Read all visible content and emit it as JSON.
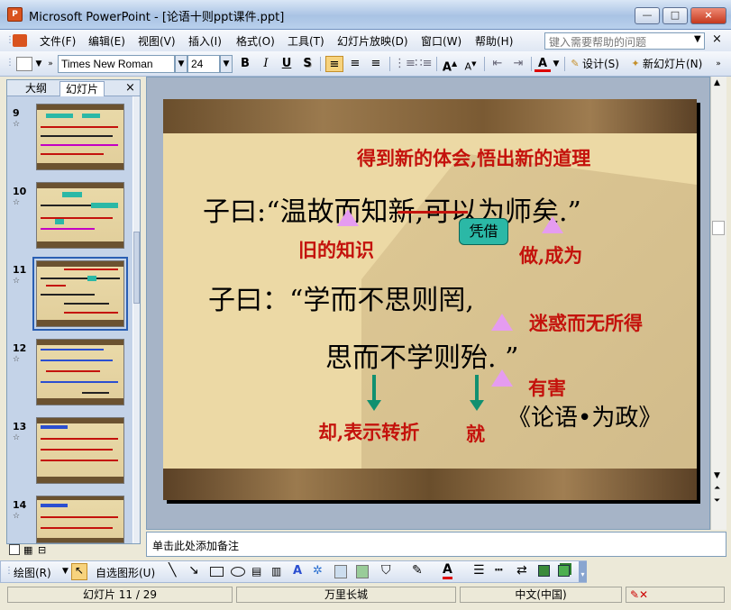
{
  "window": {
    "title": "Microsoft PowerPoint - [论语十则ppt课件.ppt]",
    "minimize": "0",
    "restore": "□",
    "close": "×"
  },
  "menu": [
    "文件(F)",
    "编辑(E)",
    "视图(V)",
    "插入(I)",
    "格式(O)",
    "工具(T)",
    "幻灯片放映(D)",
    "窗口(W)",
    "帮助(H)"
  ],
  "help": {
    "placeholder": "键入需要帮助的问题"
  },
  "toolbar": {
    "font": "Times New Roman",
    "size": "24",
    "bold": "B",
    "italic": "I",
    "underline": "U",
    "shadow": "S",
    "design": "设计(S)",
    "new_slide": "新幻灯片(N)"
  },
  "panel": {
    "tab_outline": "大纲",
    "tab_slides": "幻灯片",
    "close": "×",
    "thumbs": [
      {
        "num": "9"
      },
      {
        "num": "10"
      },
      {
        "num": "11"
      },
      {
        "num": "12"
      },
      {
        "num": "13"
      },
      {
        "num": "14"
      }
    ]
  },
  "slide": {
    "annot_top": "得到新的体会,悟出新的道理",
    "line1": "子曰:“温故而知新,可以为师矣.”",
    "callout": "凭借",
    "annot_old": "旧的知识",
    "annot_become": "做,成为",
    "line2": "子曰：“学而不思则罔,",
    "annot_confused": "迷惑而无所得",
    "line3": "思而不学则殆. ”",
    "annot_harm": "有害",
    "annot_but": "却,表示转折",
    "annot_then": "就",
    "source": "《论语•为政》"
  },
  "notes": {
    "placeholder": "单击此处添加备注"
  },
  "draw": {
    "draw_label": "绘图(R)",
    "autoshape": "自选图形(U)"
  },
  "status": {
    "slide_pos": "幻灯片 11 / 29",
    "design": "万里长城",
    "language": "中文(中国)"
  },
  "colors": {
    "annotation_red": "#c4120c",
    "triangle": "#e59cf0",
    "arrow": "#119070",
    "callout": "#2bb8a6"
  }
}
